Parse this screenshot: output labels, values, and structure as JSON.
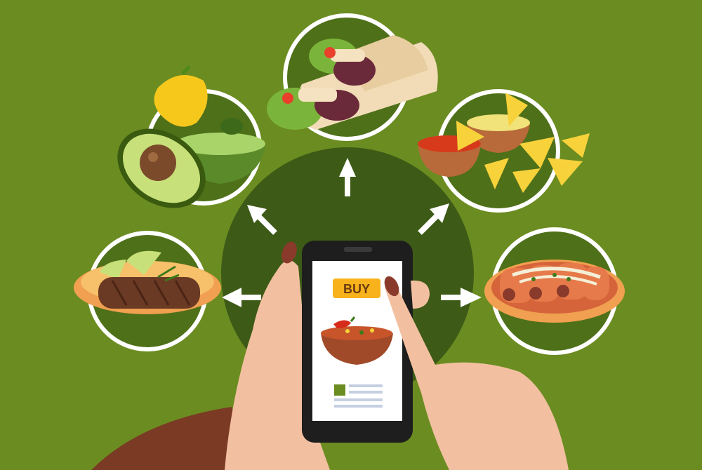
{
  "app": {
    "buy_label": "BUY"
  },
  "colors": {
    "background": "#6b8c21",
    "center_disk": "#3d5a16",
    "plate_ring": "#ffffff",
    "plate_fill": "#4e7019",
    "buy_button": "#f7b21c",
    "phone_body": "#1e1e1e",
    "skin": "#f2c0a0",
    "nail": "#8a3a2a",
    "sleeve": "#7a3a24"
  },
  "icons": [
    "avocado-icon",
    "burrito-icon",
    "nachos-icon",
    "steak-icon",
    "enchiladas-icon",
    "soup-bowl-icon",
    "arrow-icon"
  ]
}
